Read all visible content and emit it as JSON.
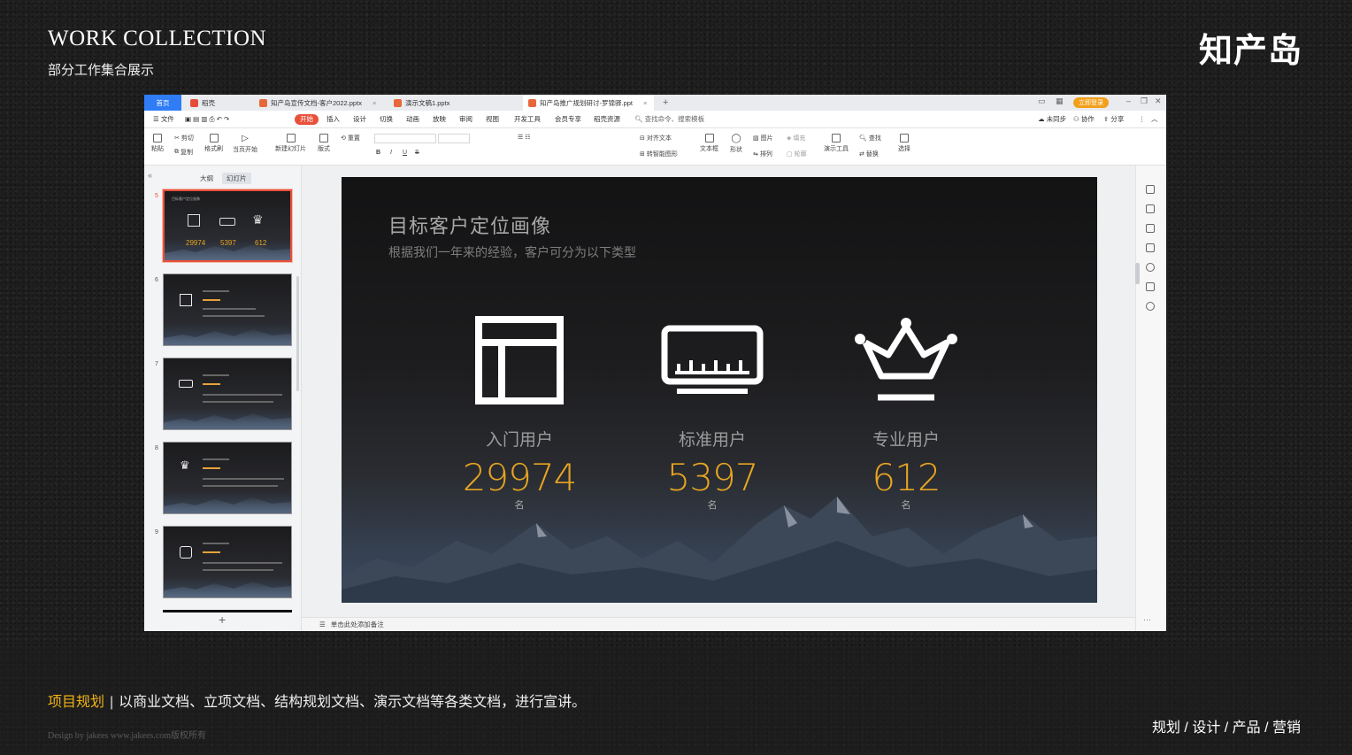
{
  "header": {
    "title": "WORK COLLECTION",
    "subtitle": "部分工作集合展示",
    "brand": "知产岛"
  },
  "window": {
    "tabs": [
      {
        "label": "首页"
      },
      {
        "label": "稻壳"
      },
      {
        "label": "知产岛宣传文档-客户2022.pptx"
      },
      {
        "label": "演示文稿1.pptx"
      },
      {
        "label": "知产岛推广规划研讨-罗锦驿.ppt"
      }
    ],
    "login_label": "立即登录",
    "menu": [
      "文件",
      "开始",
      "插入",
      "设计",
      "切换",
      "动画",
      "放映",
      "审阅",
      "视图",
      "开发工具",
      "会员专享",
      "稻壳资源"
    ],
    "search_placeholder": "查找命令、搜索模板",
    "sync_label": "未同步",
    "collab_label": "协作",
    "share_label": "分享",
    "ribbon": {
      "paste": "粘贴",
      "cut": "剪切",
      "copy": "复制",
      "format_painter": "格式刷",
      "play_from_current": "当页开始",
      "new_slide": "新建幻灯片",
      "layout": "版式",
      "reset": "重置",
      "text_box": "文本框",
      "shape": "形状",
      "picture": "图片",
      "arrange": "排列",
      "fill": "填充",
      "present_tools": "演示工具",
      "find": "查找",
      "replace": "替换",
      "select": "选择",
      "align_text": "对齐文本",
      "smart_art": "转智能图形",
      "outline": "轮廓"
    },
    "left_pane": {
      "tab_outline": "大纲",
      "tab_slides": "幻灯片",
      "slide_numbers": [
        "5",
        "6",
        "7",
        "8",
        "9"
      ],
      "add": "+"
    },
    "notes_placeholder": "单击此处添加备注",
    "slide": {
      "title": "目标客户定位画像",
      "subtitle": "根据我们一年来的经验，客户可分为以下类型",
      "segments": [
        {
          "icon": "layout-icon",
          "label": "入门用户",
          "count": "29974",
          "unit": "名"
        },
        {
          "icon": "ruler-icon",
          "label": "标准用户",
          "count": "5397",
          "unit": "名"
        },
        {
          "icon": "crown-icon",
          "label": "专业用户",
          "count": "612",
          "unit": "名"
        }
      ]
    }
  },
  "caption": {
    "highlight": "项目规划",
    "separator": "|",
    "text": "以商业文档、立项文档、结构规划文档、演示文档等各类文档，进行宣讲。"
  },
  "credit": "Design by jakees   www.jakees.com版权所有",
  "tags": "规划 / 设计 / 产品 / 营销",
  "colors": {
    "accent": "#e6a422",
    "tab_active": "#2f7cf6",
    "menu_active": "#e8503a",
    "caption_highlight": "#f2b318"
  }
}
